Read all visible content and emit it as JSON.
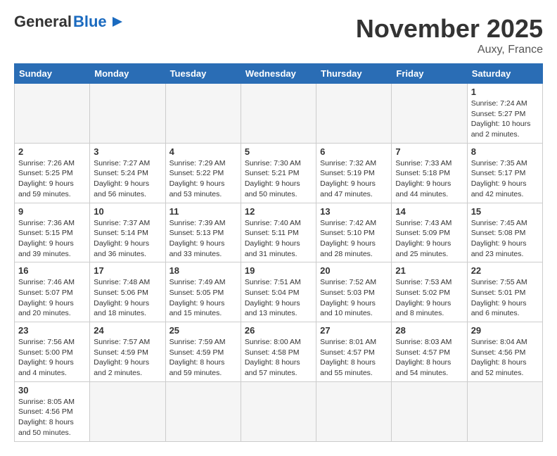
{
  "header": {
    "logo_general": "General",
    "logo_blue": "Blue",
    "month_title": "November 2025",
    "location": "Auxy, France"
  },
  "weekdays": [
    "Sunday",
    "Monday",
    "Tuesday",
    "Wednesday",
    "Thursday",
    "Friday",
    "Saturday"
  ],
  "weeks": [
    [
      {
        "day": "",
        "info": ""
      },
      {
        "day": "",
        "info": ""
      },
      {
        "day": "",
        "info": ""
      },
      {
        "day": "",
        "info": ""
      },
      {
        "day": "",
        "info": ""
      },
      {
        "day": "",
        "info": ""
      },
      {
        "day": "1",
        "info": "Sunrise: 7:24 AM\nSunset: 5:27 PM\nDaylight: 10 hours\nand 2 minutes."
      }
    ],
    [
      {
        "day": "2",
        "info": "Sunrise: 7:26 AM\nSunset: 5:25 PM\nDaylight: 9 hours\nand 59 minutes."
      },
      {
        "day": "3",
        "info": "Sunrise: 7:27 AM\nSunset: 5:24 PM\nDaylight: 9 hours\nand 56 minutes."
      },
      {
        "day": "4",
        "info": "Sunrise: 7:29 AM\nSunset: 5:22 PM\nDaylight: 9 hours\nand 53 minutes."
      },
      {
        "day": "5",
        "info": "Sunrise: 7:30 AM\nSunset: 5:21 PM\nDaylight: 9 hours\nand 50 minutes."
      },
      {
        "day": "6",
        "info": "Sunrise: 7:32 AM\nSunset: 5:19 PM\nDaylight: 9 hours\nand 47 minutes."
      },
      {
        "day": "7",
        "info": "Sunrise: 7:33 AM\nSunset: 5:18 PM\nDaylight: 9 hours\nand 44 minutes."
      },
      {
        "day": "8",
        "info": "Sunrise: 7:35 AM\nSunset: 5:17 PM\nDaylight: 9 hours\nand 42 minutes."
      }
    ],
    [
      {
        "day": "9",
        "info": "Sunrise: 7:36 AM\nSunset: 5:15 PM\nDaylight: 9 hours\nand 39 minutes."
      },
      {
        "day": "10",
        "info": "Sunrise: 7:37 AM\nSunset: 5:14 PM\nDaylight: 9 hours\nand 36 minutes."
      },
      {
        "day": "11",
        "info": "Sunrise: 7:39 AM\nSunset: 5:13 PM\nDaylight: 9 hours\nand 33 minutes."
      },
      {
        "day": "12",
        "info": "Sunrise: 7:40 AM\nSunset: 5:11 PM\nDaylight: 9 hours\nand 31 minutes."
      },
      {
        "day": "13",
        "info": "Sunrise: 7:42 AM\nSunset: 5:10 PM\nDaylight: 9 hours\nand 28 minutes."
      },
      {
        "day": "14",
        "info": "Sunrise: 7:43 AM\nSunset: 5:09 PM\nDaylight: 9 hours\nand 25 minutes."
      },
      {
        "day": "15",
        "info": "Sunrise: 7:45 AM\nSunset: 5:08 PM\nDaylight: 9 hours\nand 23 minutes."
      }
    ],
    [
      {
        "day": "16",
        "info": "Sunrise: 7:46 AM\nSunset: 5:07 PM\nDaylight: 9 hours\nand 20 minutes."
      },
      {
        "day": "17",
        "info": "Sunrise: 7:48 AM\nSunset: 5:06 PM\nDaylight: 9 hours\nand 18 minutes."
      },
      {
        "day": "18",
        "info": "Sunrise: 7:49 AM\nSunset: 5:05 PM\nDaylight: 9 hours\nand 15 minutes."
      },
      {
        "day": "19",
        "info": "Sunrise: 7:51 AM\nSunset: 5:04 PM\nDaylight: 9 hours\nand 13 minutes."
      },
      {
        "day": "20",
        "info": "Sunrise: 7:52 AM\nSunset: 5:03 PM\nDaylight: 9 hours\nand 10 minutes."
      },
      {
        "day": "21",
        "info": "Sunrise: 7:53 AM\nSunset: 5:02 PM\nDaylight: 9 hours\nand 8 minutes."
      },
      {
        "day": "22",
        "info": "Sunrise: 7:55 AM\nSunset: 5:01 PM\nDaylight: 9 hours\nand 6 minutes."
      }
    ],
    [
      {
        "day": "23",
        "info": "Sunrise: 7:56 AM\nSunset: 5:00 PM\nDaylight: 9 hours\nand 4 minutes."
      },
      {
        "day": "24",
        "info": "Sunrise: 7:57 AM\nSunset: 4:59 PM\nDaylight: 9 hours\nand 2 minutes."
      },
      {
        "day": "25",
        "info": "Sunrise: 7:59 AM\nSunset: 4:59 PM\nDaylight: 8 hours\nand 59 minutes."
      },
      {
        "day": "26",
        "info": "Sunrise: 8:00 AM\nSunset: 4:58 PM\nDaylight: 8 hours\nand 57 minutes."
      },
      {
        "day": "27",
        "info": "Sunrise: 8:01 AM\nSunset: 4:57 PM\nDaylight: 8 hours\nand 55 minutes."
      },
      {
        "day": "28",
        "info": "Sunrise: 8:03 AM\nSunset: 4:57 PM\nDaylight: 8 hours\nand 54 minutes."
      },
      {
        "day": "29",
        "info": "Sunrise: 8:04 AM\nSunset: 4:56 PM\nDaylight: 8 hours\nand 52 minutes."
      }
    ],
    [
      {
        "day": "30",
        "info": "Sunrise: 8:05 AM\nSunset: 4:56 PM\nDaylight: 8 hours\nand 50 minutes."
      },
      {
        "day": "",
        "info": ""
      },
      {
        "day": "",
        "info": ""
      },
      {
        "day": "",
        "info": ""
      },
      {
        "day": "",
        "info": ""
      },
      {
        "day": "",
        "info": ""
      },
      {
        "day": "",
        "info": ""
      }
    ]
  ]
}
